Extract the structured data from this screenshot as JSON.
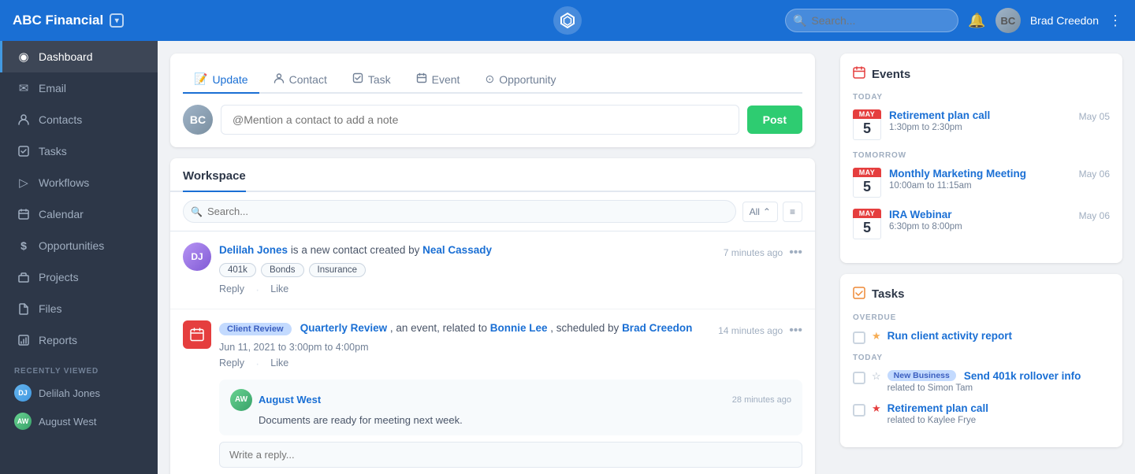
{
  "topnav": {
    "brand": "ABC Financial",
    "search_placeholder": "Search...",
    "user_name": "Brad Creedon",
    "logo_symbol": "⬡"
  },
  "sidebar": {
    "items": [
      {
        "id": "dashboard",
        "label": "Dashboard",
        "icon": "◎",
        "active": true
      },
      {
        "id": "email",
        "label": "Email",
        "icon": "✉"
      },
      {
        "id": "contacts",
        "label": "Contacts",
        "icon": "👤"
      },
      {
        "id": "tasks",
        "label": "Tasks",
        "icon": "☑"
      },
      {
        "id": "workflows",
        "label": "Workflows",
        "icon": "▷"
      },
      {
        "id": "calendar",
        "label": "Calendar",
        "icon": "📅"
      },
      {
        "id": "opportunities",
        "label": "Opportunities",
        "icon": "$"
      },
      {
        "id": "projects",
        "label": "Projects",
        "icon": "📁"
      },
      {
        "id": "files",
        "label": "Files",
        "icon": "🗂"
      },
      {
        "id": "reports",
        "label": "Reports",
        "icon": "📊"
      }
    ],
    "recently_viewed_label": "RECENTLY VIEWED",
    "recently_viewed": [
      {
        "id": "delilah-jones",
        "label": "Delilah Jones",
        "initials": "DJ",
        "color": "blue"
      },
      {
        "id": "august-west",
        "label": "August West",
        "initials": "AW",
        "color": "green"
      }
    ]
  },
  "post": {
    "tabs": [
      {
        "id": "update",
        "label": "Update",
        "icon": "📝",
        "active": true
      },
      {
        "id": "contact",
        "label": "Contact",
        "icon": "👤"
      },
      {
        "id": "task",
        "label": "Task",
        "icon": "☑"
      },
      {
        "id": "event",
        "label": "Event",
        "icon": "📅"
      },
      {
        "id": "opportunity",
        "label": "Opportunity",
        "icon": "⊙"
      }
    ],
    "input_placeholder": "@Mention a contact to add a note",
    "post_button": "Post"
  },
  "workspace": {
    "title": "Workspace",
    "search_placeholder": "Search...",
    "filter_label": "All",
    "feed_items": [
      {
        "id": "item1",
        "avatar_initials": "DJ",
        "main_text_before": "Delilah Jones",
        "main_text_middle": " is a new contact created by ",
        "main_text_link": "Neal Cassady",
        "time": "7 minutes ago",
        "tags": [
          "401k",
          "Bonds",
          "Insurance"
        ],
        "actions": [
          "Reply",
          "Like"
        ]
      },
      {
        "id": "item2",
        "badge": "Client Review",
        "event_name": "Quarterly Review",
        "event_text_middle": ", an event, related to ",
        "event_link1": "Bonnie Lee",
        "event_text_after": ", scheduled by ",
        "event_link2": "Brad Creedon",
        "time": "14 minutes ago",
        "date_text": "Jun 11, 2021 to 3:00pm to 4:00pm",
        "actions": [
          "Reply",
          "Like"
        ],
        "reply": {
          "avatar_initials": "AW",
          "name": "August West",
          "text": "Documents are ready for meeting next week.",
          "time": "28 minutes ago"
        },
        "reply_placeholder": "Write a reply..."
      }
    ]
  },
  "events_panel": {
    "title": "Events",
    "icon": "📅",
    "today_label": "TODAY",
    "tomorrow_label": "TOMORROW",
    "events": [
      {
        "id": "evt1",
        "name": "Retirement plan call",
        "time": "1:30pm to 2:30pm",
        "date": "May 05",
        "month": "MAY",
        "day": "5",
        "section": "today"
      },
      {
        "id": "evt2",
        "name": "Monthly Marketing Meeting",
        "time": "10:00am to 11:15am",
        "date": "May 06",
        "month": "MAY",
        "day": "5",
        "section": "tomorrow"
      },
      {
        "id": "evt3",
        "name": "IRA Webinar",
        "time": "6:30pm to 8:00pm",
        "date": "May 06",
        "month": "MAY",
        "day": "5",
        "section": "tomorrow"
      }
    ]
  },
  "tasks_panel": {
    "title": "Tasks",
    "icon": "☑",
    "overdue_label": "OVERDUE",
    "today_label": "TODAY",
    "tasks": [
      {
        "id": "task1",
        "name": "Run client activity report",
        "star": "filled",
        "star_color": "gold",
        "section": "overdue",
        "related": ""
      },
      {
        "id": "task2",
        "name": "Send 401k rollover info",
        "badge": "New Business",
        "star": "empty",
        "section": "today",
        "related": "related to Simon Tam"
      },
      {
        "id": "task3",
        "name": "Retirement plan call",
        "star": "filled",
        "star_color": "red",
        "section": "today",
        "related": "related to Kaylee Frye"
      }
    ]
  }
}
